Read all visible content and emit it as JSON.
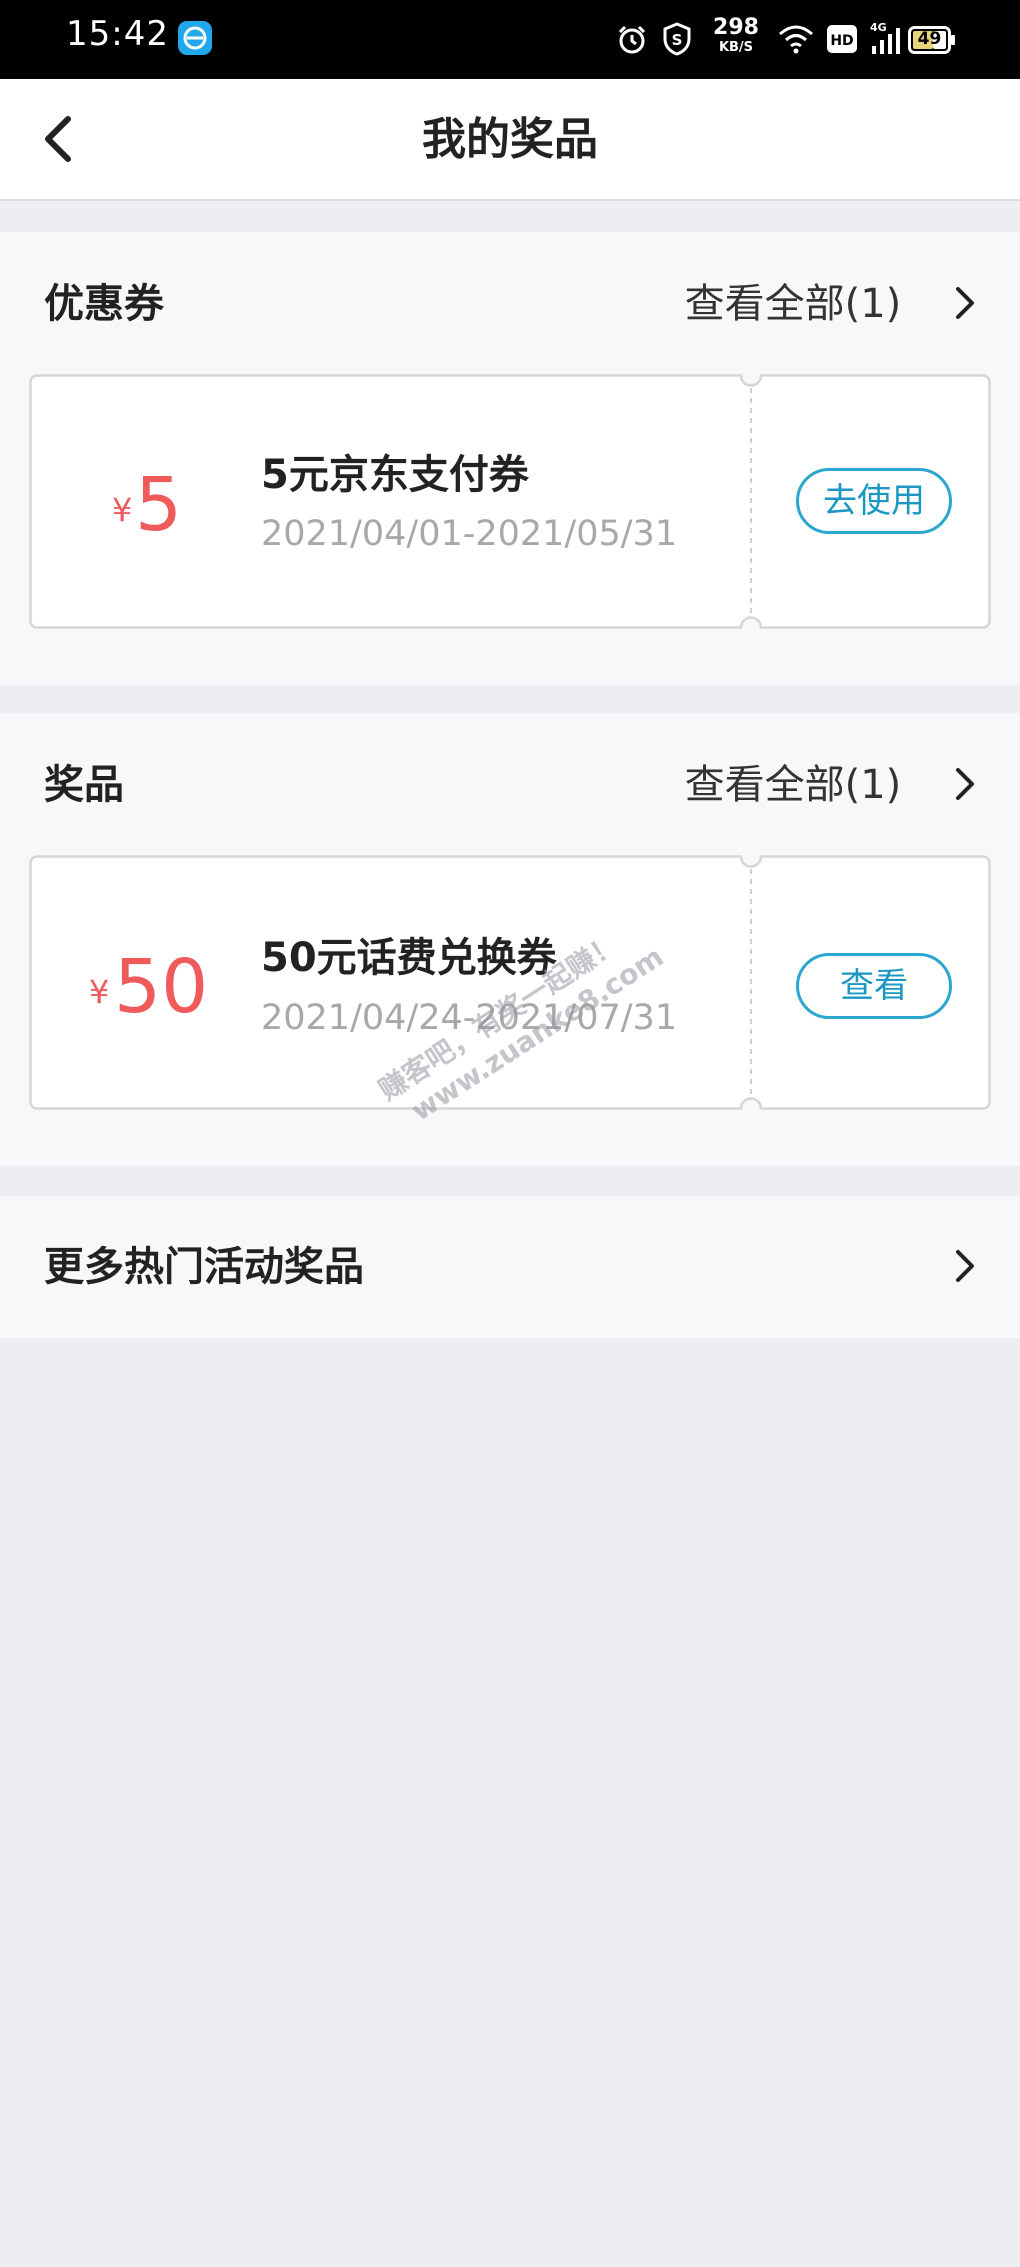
{
  "status_bar": {
    "time": "15:42",
    "net_speed_value": "298",
    "net_speed_unit": "KB/S",
    "battery_level": "49",
    "icons": [
      "app-icon",
      "alarm-icon",
      "shield-s-icon",
      "wifi-icon",
      "hd-icon",
      "cellular-4g-icon",
      "battery-icon"
    ]
  },
  "nav": {
    "title": "我的奖品",
    "back_icon": "chevron-left-icon"
  },
  "coupons_section": {
    "title": "优惠券",
    "view_all_label": "查看全部(1)",
    "items": [
      {
        "currency_symbol": "¥",
        "amount": "5",
        "name": "5元京东支付券",
        "validity": "2021/04/01-2021/05/31",
        "action_label": "去使用"
      }
    ]
  },
  "prizes_section": {
    "title": "奖品",
    "view_all_label": "查看全部(1)",
    "items": [
      {
        "currency_symbol": "¥",
        "amount": "50",
        "name": "50元话费兑换券",
        "validity": "2021/04/24-2021/07/31",
        "action_label": "查看"
      }
    ]
  },
  "more_row": {
    "label": "更多热门活动奖品"
  },
  "watermark": {
    "line1": "赚客吧，有奖一起赚！",
    "line2": "www.zuanke8.com"
  },
  "colors": {
    "amount_red": "#ef5b5b",
    "button_blue": "#2aa6cf",
    "page_background": "#eeeef2",
    "section_background": "#f8f8fa"
  }
}
